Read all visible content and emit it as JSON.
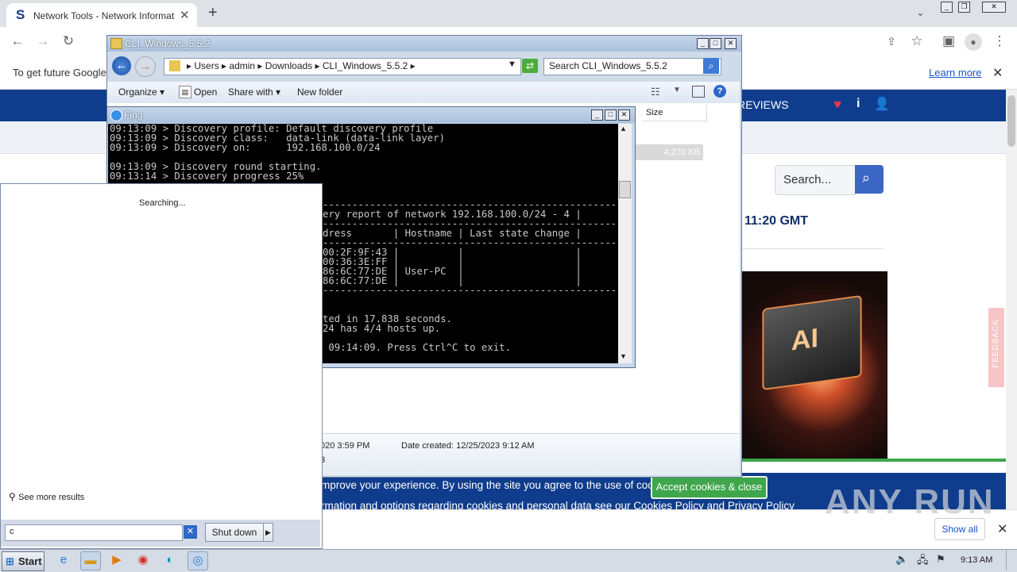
{
  "browser": {
    "tab_title": "Network Tools - Network Information",
    "favicon": "S",
    "new_tab": "+",
    "infobar_text": "To get future Google",
    "learn_more": "Learn more"
  },
  "site": {
    "reviews": "REVIEWS",
    "search_placeholder": "Search...",
    "time_text": "11:20 GMT",
    "hero_text": "AI",
    "feedback": "FEEDBACK",
    "cookie_text": "mprove your experience. By using the site you agree to the use of cookies.",
    "cookie_button": "Accept cookies & close",
    "cookie_text2": "rmation and options regarding cookies and personal data see our Cookies Policy and Privacy Policy",
    "show_all": "Show all"
  },
  "explorer": {
    "title": "CLI_Windows_5.5.2",
    "breadcrumb": [
      "Users",
      "admin",
      "Downloads",
      "CLI_Windows_5.5.2"
    ],
    "search_placeholder": "Search CLI_Windows_5.5.2",
    "commands": [
      "Organize",
      "Open",
      "Share with",
      "New folder"
    ],
    "column_size": "Size",
    "file_size": "4,270 KB",
    "details_modified": "020 3:59 PM",
    "details_created": "Date created: 12/25/2023 9:12 AM",
    "details_extra": "3"
  },
  "fing": {
    "title": "Fing",
    "lines": [
      "09:13:09 > Discovery profile: Default discovery profile",
      "09:13:09 > Discovery class:   data-link (data-link layer)",
      "09:13:09 > Discovery on:      192.168.100.0/24",
      "",
      "09:13:09 > Discovery round starting.",
      "09:13:14 > Discovery progress 25%"
    ],
    "right_lines": [
      "---------------------------------------------------",
      "ery report of network 192.168.100.0/24 - 4 |",
      "---------------------------------------------------",
      "dress       | Hostname | Last state change |",
      "---------------------------------------------------",
      "00:2F:9F:43 |          |                   |",
      "00:36:3E:FF |          |                   |",
      "86:6C:77:DE | User-PC  |                   |",
      "86:6C:77:DE |          |                   |",
      "---------------------------------------------------",
      "",
      "",
      "ted in 17.838 seconds.",
      "24 has 4/4 hosts up.",
      "",
      " 09:14:09. Press Ctrl^C to exit."
    ]
  },
  "startmenu": {
    "searching": "Searching...",
    "see_more": "See more results",
    "query": "c",
    "shutdown": "Shut down"
  },
  "taskbar": {
    "start": "Start",
    "clock": "9:13 AM"
  },
  "watermark": "ANY RUN",
  "colors": {
    "site_nav": "#0f3c8c",
    "accept_green": "#3fa64b",
    "console_bg": "#000000"
  }
}
